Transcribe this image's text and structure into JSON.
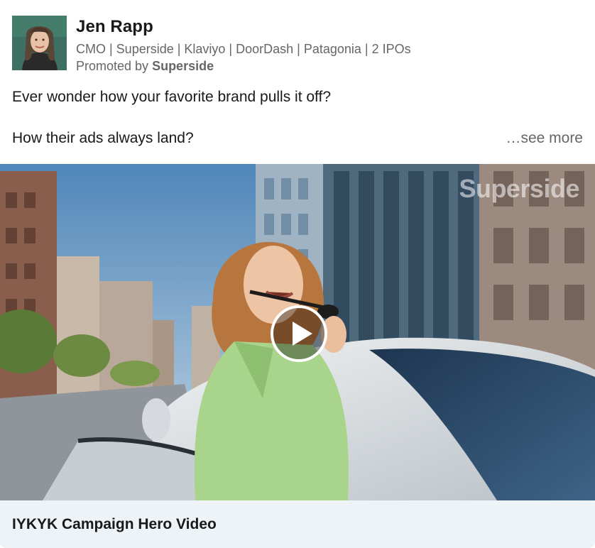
{
  "author": {
    "name": "Jen Rapp",
    "headline": "CMO | Superside | Klaviyo | DoorDash | Patagonia | 2 IPOs",
    "promoted_prefix": "Promoted by ",
    "promoted_by": "Superside"
  },
  "post": {
    "line1": "Ever wonder how your favorite brand pulls it off?",
    "line2": "How their ads always land?",
    "see_more": "…see more"
  },
  "media": {
    "watermark": "Superside",
    "play_icon": "play-icon"
  },
  "caption": {
    "title": "IYKYK Campaign Hero Video"
  },
  "colors": {
    "caption_bg": "#eef3f8",
    "text_primary": "#191919",
    "text_secondary": "#666666"
  }
}
